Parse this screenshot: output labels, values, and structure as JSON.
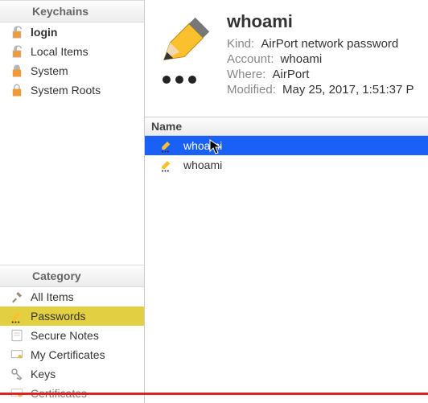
{
  "sidebar": {
    "keychains_header": "Keychains",
    "keychains": [
      {
        "label": "login"
      },
      {
        "label": "Local Items"
      },
      {
        "label": "System"
      },
      {
        "label": "System Roots"
      }
    ],
    "category_header": "Category",
    "categories": [
      {
        "label": "All Items"
      },
      {
        "label": "Passwords"
      },
      {
        "label": "Secure Notes"
      },
      {
        "label": "My Certificates"
      },
      {
        "label": "Keys"
      },
      {
        "label": "Certificates"
      }
    ]
  },
  "detail": {
    "title": "whoami",
    "kind_label": "Kind:",
    "kind_value": "AirPort network password",
    "account_label": "Account:",
    "account_value": "whoami",
    "where_label": "Where:",
    "where_value": "AirPort",
    "modified_label": "Modified:",
    "modified_value": "May 25, 2017, 1:51:37 P"
  },
  "list": {
    "header_name": "Name",
    "rows": [
      {
        "name": "whoami",
        "selected": true
      },
      {
        "name": "whoami",
        "selected": false
      }
    ]
  },
  "colors": {
    "selection": "#1a5ff6",
    "category_highlight": "#e2cf42",
    "pencil_body": "#fbc02d",
    "pencil_tip": "#d38a3a",
    "lock_body": "#f09a3a",
    "lock_open": "#b6b6b6"
  }
}
